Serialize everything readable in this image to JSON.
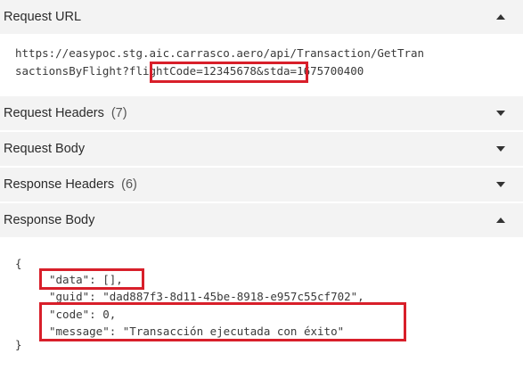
{
  "sections": {
    "request_url": {
      "title": "Request URL"
    },
    "request_headers": {
      "title": "Request Headers",
      "count": "(7)"
    },
    "request_body": {
      "title": "Request Body"
    },
    "response_headers": {
      "title": "Response Headers",
      "count": "(6)"
    },
    "response_body": {
      "title": "Response Body"
    }
  },
  "url": {
    "line1": "https://easypoc.stg.aic.carrasco.aero/api/Transaction/GetTran",
    "line2": "sactionsByFlight?flightCode=12345678&stda=1675700400"
  },
  "response_json": {
    "open": "{",
    "data": "\"data\": [],",
    "guid": "\"guid\": \"dad887f3-8d11-45be-8918-e957c55cf702\",",
    "code": "\"code\": 0,",
    "message": "\"message\": \"Transacción ejecutada con éxito\"",
    "close": "}"
  },
  "highlight_color": "#d81f2a"
}
